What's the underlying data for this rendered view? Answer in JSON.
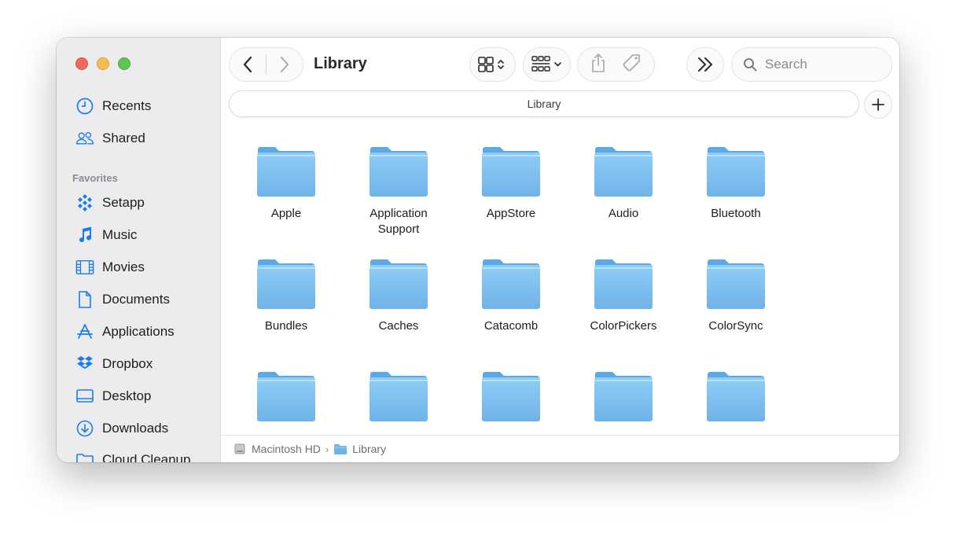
{
  "window": {
    "title": "Library",
    "traffic_lights": [
      "close",
      "minimize",
      "zoom"
    ]
  },
  "sidebar": {
    "top_items": [
      {
        "label": "Recents",
        "icon": "clock-icon"
      },
      {
        "label": "Shared",
        "icon": "shared-people-icon"
      }
    ],
    "favorites_header": "Favorites",
    "favorites": [
      {
        "label": "Setapp",
        "icon": "setapp-icon"
      },
      {
        "label": "Music",
        "icon": "music-note-icon"
      },
      {
        "label": "Movies",
        "icon": "film-icon"
      },
      {
        "label": "Documents",
        "icon": "document-icon"
      },
      {
        "label": "Applications",
        "icon": "applications-icon"
      },
      {
        "label": "Dropbox",
        "icon": "dropbox-icon"
      },
      {
        "label": "Desktop",
        "icon": "desktop-icon"
      },
      {
        "label": "Downloads",
        "icon": "download-icon"
      },
      {
        "label": "Cloud Cleanup...",
        "icon": "folder-icon"
      }
    ]
  },
  "toolbar": {
    "title": "Library",
    "search_placeholder": "Search"
  },
  "path_bar": {
    "label": "Library"
  },
  "folders": [
    "Apple",
    "Application Support",
    "AppStore",
    "Audio",
    "Bluetooth",
    "Bundles",
    "Caches",
    "Catacomb",
    "ColorPickers",
    "ColorSync",
    "",
    "",
    "",
    "",
    ""
  ],
  "status_bar": {
    "crumbs": [
      "Macintosh HD",
      "Library"
    ],
    "separator": "›"
  },
  "colors": {
    "folder_top": "#8fcdf5",
    "folder_bottom": "#6fb3e8",
    "sidebar_icon": "#1a7cf0",
    "close": "#ee6a5f",
    "minimize": "#f5bd4f",
    "zoom": "#61c454"
  }
}
